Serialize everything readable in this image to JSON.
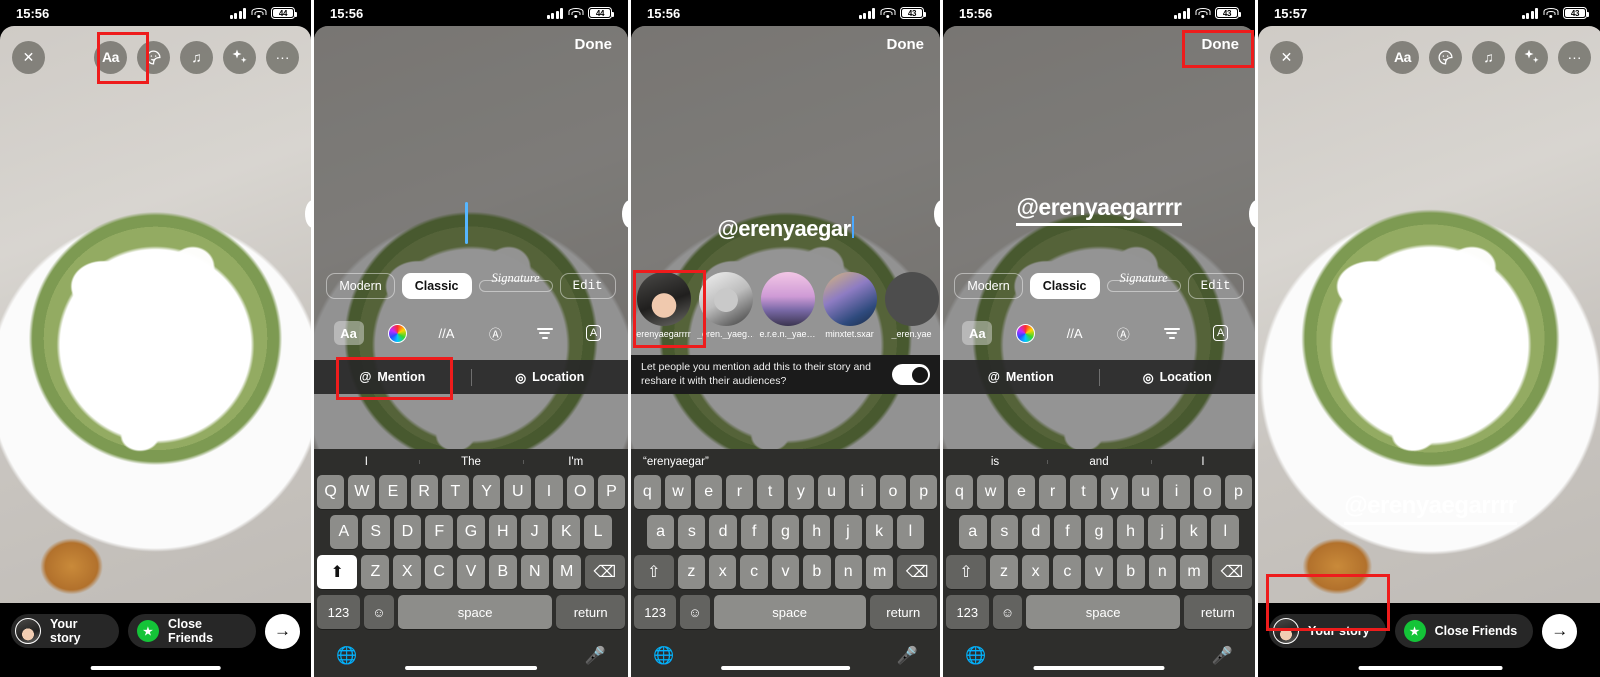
{
  "app": "Instagram Story Editor",
  "status_bars": [
    {
      "time": "15:56",
      "battery": "44"
    },
    {
      "time": "15:56",
      "battery": "44"
    },
    {
      "time": "15:56",
      "battery": "43"
    },
    {
      "time": "15:56",
      "battery": "43"
    },
    {
      "time": "15:57",
      "battery": "43"
    }
  ],
  "toolbar": {
    "close": "✕",
    "text": "Aa",
    "sticker": "sticker-icon",
    "music": "♫",
    "effects": "effects-icon",
    "more": "···"
  },
  "done_label": "Done",
  "font_styles": {
    "modern": "Modern",
    "classic": "Classic",
    "signature": "Signature",
    "edit": "Edit"
  },
  "text_tools": {
    "size": "Aa",
    "color": "color-wheel-icon",
    "animate": "//A",
    "glow": "glow-a-icon",
    "align": "align-icon",
    "background": "A"
  },
  "actions": {
    "mention": "Mention",
    "mention_symbol": "@",
    "location": "Location",
    "location_symbol": "◎"
  },
  "panel1": {
    "name": "story-editor-initial"
  },
  "panel2": {
    "name": "text-entry-empty"
  },
  "panel3": {
    "typed_text": "@erenyaegar",
    "reshare_prompt": "Let people you mention add this to their story and reshare it with their audiences?",
    "toggle_state": "on",
    "suggestions": [
      {
        "username": "erenyaegarrrr",
        "avatar": "a1"
      },
      {
        "username": "_eren._yaeg…",
        "avatar": "a2"
      },
      {
        "username": "e.r.e.n._yae…",
        "avatar": "a3"
      },
      {
        "username": "minxtet.sxar",
        "avatar": "a4"
      },
      {
        "username": "_eren.yae",
        "avatar": "a5"
      }
    ]
  },
  "panel4": {
    "mention_text": "@erenyaegarrrr"
  },
  "panel5": {
    "mention_text": "@erenyaegarrrr"
  },
  "keyboards": {
    "upper": {
      "predictions": [
        "I",
        "The",
        "I'm"
      ],
      "row1": [
        "Q",
        "W",
        "E",
        "R",
        "T",
        "Y",
        "U",
        "I",
        "O",
        "P"
      ],
      "row2": [
        "A",
        "S",
        "D",
        "F",
        "G",
        "H",
        "J",
        "K",
        "L"
      ],
      "row3": [
        "Z",
        "X",
        "C",
        "V",
        "B",
        "N",
        "M"
      ],
      "shift": "⬆",
      "backspace": "⌫",
      "numbers": "123",
      "emoji": "☺",
      "space": "space",
      "return": "return",
      "globe": "globe-icon",
      "mic": "mic-icon"
    },
    "lower3": {
      "predictions": [
        "“erenyaegar”",
        "",
        ""
      ],
      "row1": [
        "q",
        "w",
        "e",
        "r",
        "t",
        "y",
        "u",
        "i",
        "o",
        "p"
      ],
      "row2": [
        "a",
        "s",
        "d",
        "f",
        "g",
        "h",
        "j",
        "k",
        "l"
      ],
      "row3": [
        "z",
        "x",
        "c",
        "v",
        "b",
        "n",
        "m"
      ]
    },
    "lower4": {
      "predictions": [
        "is",
        "and",
        "I"
      ],
      "row1": [
        "q",
        "w",
        "e",
        "r",
        "t",
        "y",
        "u",
        "i",
        "o",
        "p"
      ],
      "row2": [
        "a",
        "s",
        "d",
        "f",
        "g",
        "h",
        "j",
        "k",
        "l"
      ],
      "row3": [
        "z",
        "x",
        "c",
        "v",
        "b",
        "n",
        "m"
      ]
    }
  },
  "share": {
    "your_story": "Your story",
    "close_friends": "Close Friends",
    "next": "→"
  },
  "colors": {
    "accent_green": "#14c438",
    "annotation_red": "#ee1c1c",
    "matcha": "#93ab62"
  }
}
